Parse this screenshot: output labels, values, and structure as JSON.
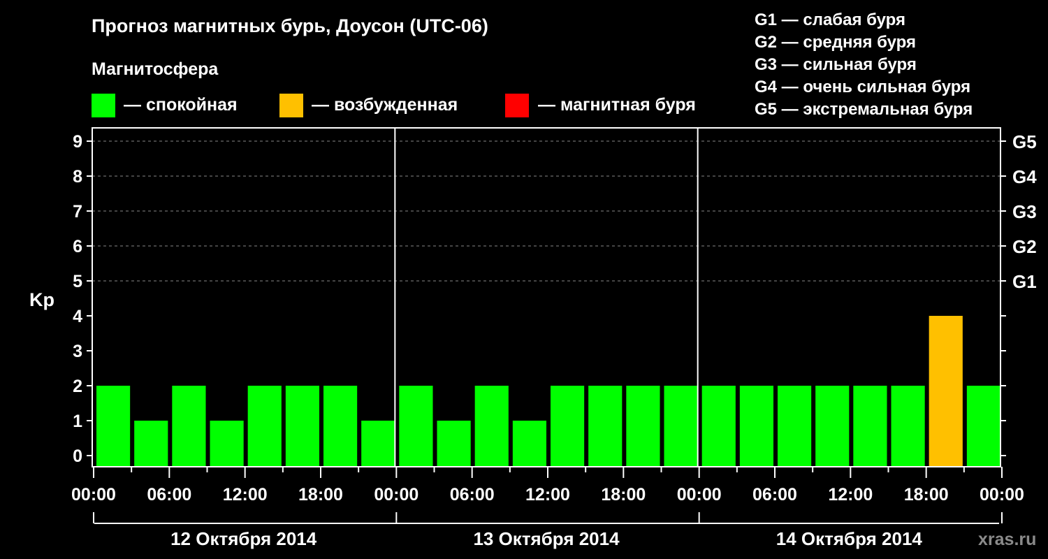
{
  "title": "Прогноз магнитных бурь, Доусон (UTC-06)",
  "magnetosphere_label": "Магнитосфера",
  "legend": [
    {
      "label": "— спокойная",
      "color": "#00ff00"
    },
    {
      "label": "— возбужденная",
      "color": "#ffc000"
    },
    {
      "label": "— магнитная буря",
      "color": "#ff0000"
    }
  ],
  "g_legend": [
    "G1 — слабая буря",
    "G2 — средняя буря",
    "G3 — сильная буря",
    "G4 — очень сильная буря",
    "G5 — экстремальная буря"
  ],
  "watermark": "xras.ru",
  "chart_data": {
    "type": "bar",
    "title": "Прогноз магнитных бурь, Доусон (UTC-06)",
    "ylabel": "Kp",
    "ylim": [
      0,
      9
    ],
    "yticks": [
      "0",
      "1",
      "2",
      "3",
      "4",
      "5",
      "6",
      "7",
      "8",
      "9"
    ],
    "right_ticks": [
      {
        "kp": 5,
        "label": "G1"
      },
      {
        "kp": 6,
        "label": "G2"
      },
      {
        "kp": 7,
        "label": "G3"
      },
      {
        "kp": 8,
        "label": "G4"
      },
      {
        "kp": 9,
        "label": "G5"
      }
    ],
    "grid": "dashed horizontal at Kp 5-9",
    "xtick_labels": [
      "00:00",
      "06:00",
      "12:00",
      "18:00",
      "00:00",
      "06:00",
      "12:00",
      "18:00",
      "00:00",
      "06:00",
      "12:00",
      "18:00",
      "00:00"
    ],
    "days": [
      "12 Октября 2014",
      "13 Октября 2014",
      "14 Октября 2014"
    ],
    "interval_hours": 3,
    "values": [
      2,
      1,
      2,
      1,
      2,
      2,
      2,
      1,
      2,
      1,
      2,
      1,
      2,
      2,
      2,
      2,
      2,
      2,
      2,
      2,
      2,
      2,
      4,
      2
    ],
    "colors": {
      "quiet": "#00ff00",
      "active": "#ffc000",
      "storm": "#ff0000"
    }
  }
}
